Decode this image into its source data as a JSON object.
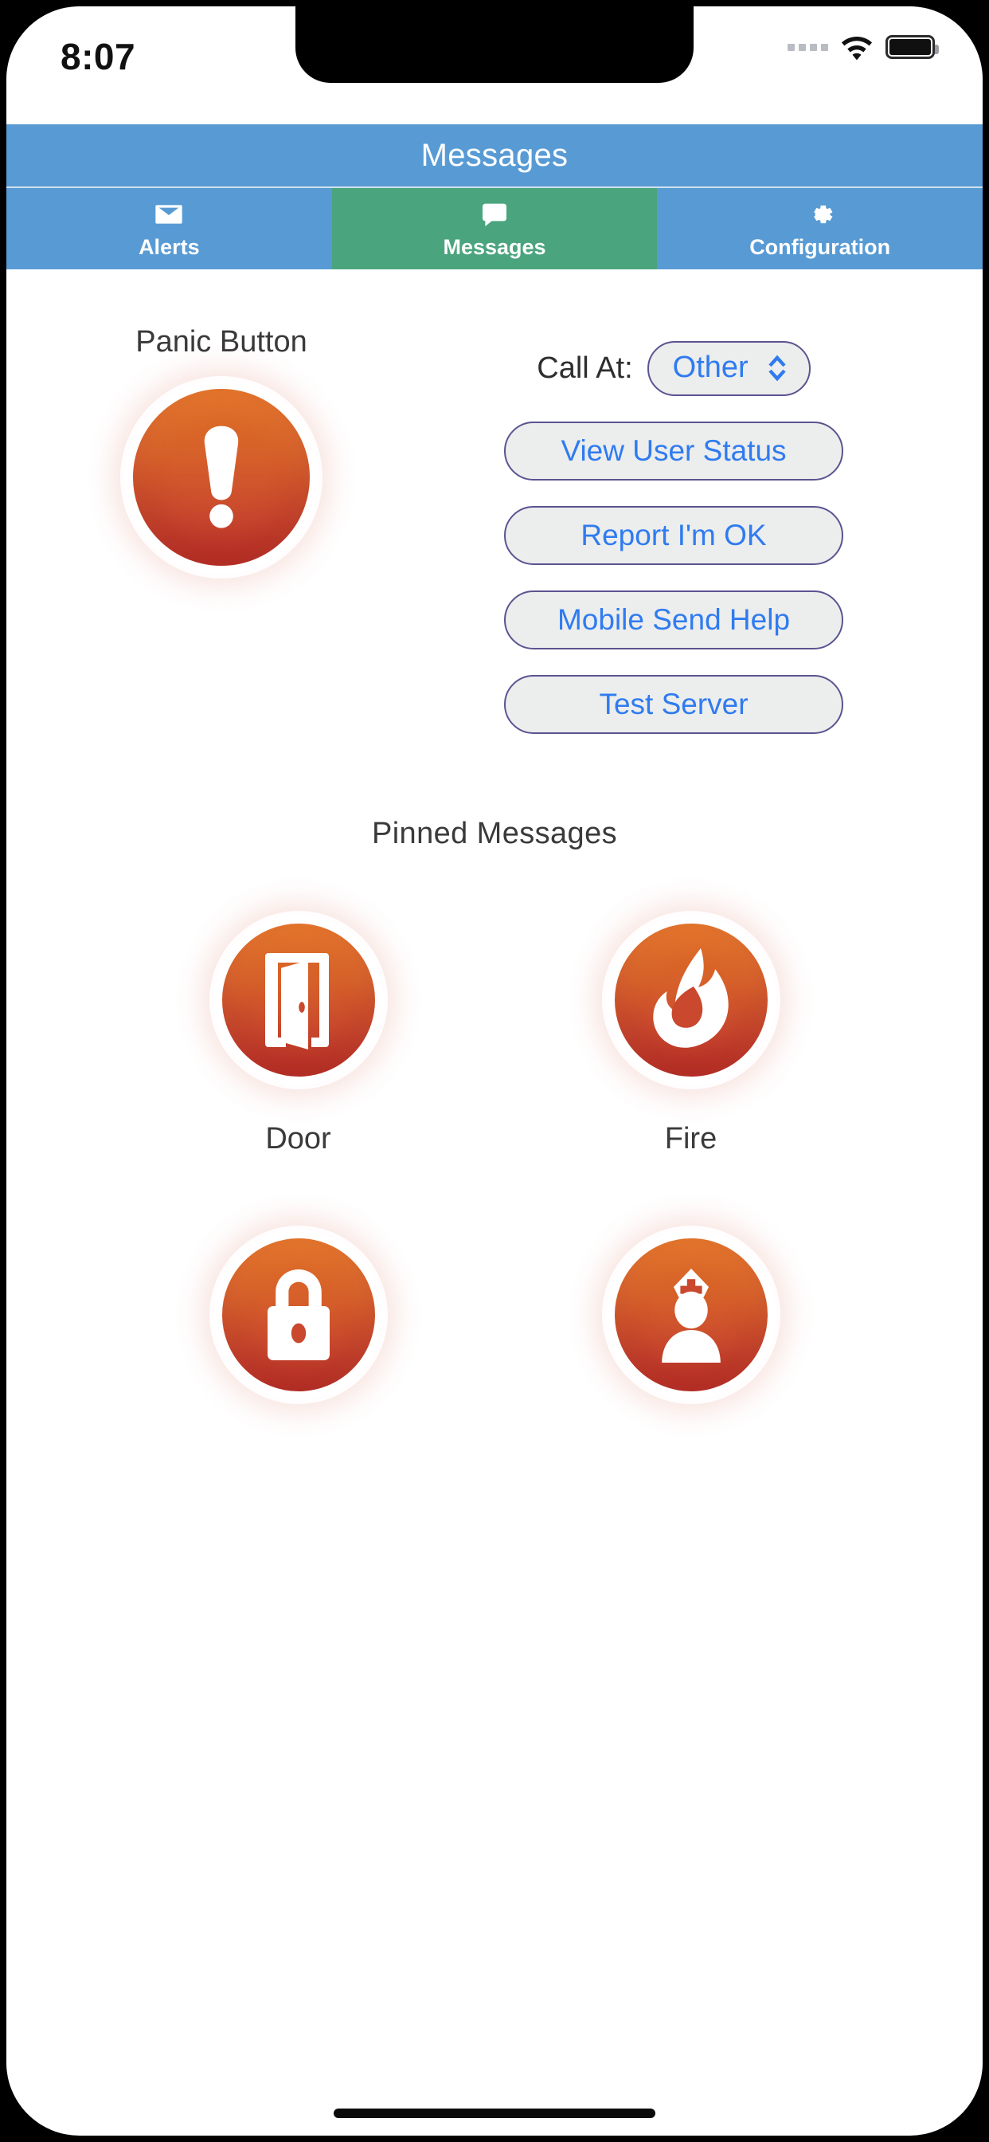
{
  "status_bar": {
    "time": "8:07",
    "signal_icon": "signal-dots-icon",
    "wifi_icon": "wifi-icon",
    "battery_icon": "battery-icon"
  },
  "header": {
    "title": "Messages"
  },
  "tabs": [
    {
      "label": "Alerts",
      "icon": "envelope-icon",
      "active": false
    },
    {
      "label": "Messages",
      "icon": "chat-bubble-icon",
      "active": true
    },
    {
      "label": "Configuration",
      "icon": "gear-icon",
      "active": false
    }
  ],
  "panic": {
    "label": "Panic Button",
    "icon": "exclamation-icon"
  },
  "controls": {
    "call_at_label": "Call At:",
    "call_at_value": "Other",
    "call_at_chevron": "chevron-up-down-icon",
    "buttons": [
      "View User Status",
      "Report I'm OK",
      "Mobile Send Help",
      "Test Server"
    ]
  },
  "pinned": {
    "title": "Pinned Messages",
    "tiles": [
      {
        "label": "Door",
        "icon": "open-door-icon"
      },
      {
        "label": "Fire",
        "icon": "flame-icon"
      },
      {
        "label": "",
        "icon": "lock-icon"
      },
      {
        "label": "",
        "icon": "nurse-icon"
      }
    ]
  },
  "colors": {
    "header_blue": "#589bd4",
    "active_tab_green": "#4aa47d",
    "button_text_blue": "#2f7bf0",
    "button_border_purple": "#5b5490",
    "button_fill_gray": "#eceded",
    "alert_orange": "#DE6E24",
    "alert_red": "#BB3228"
  }
}
